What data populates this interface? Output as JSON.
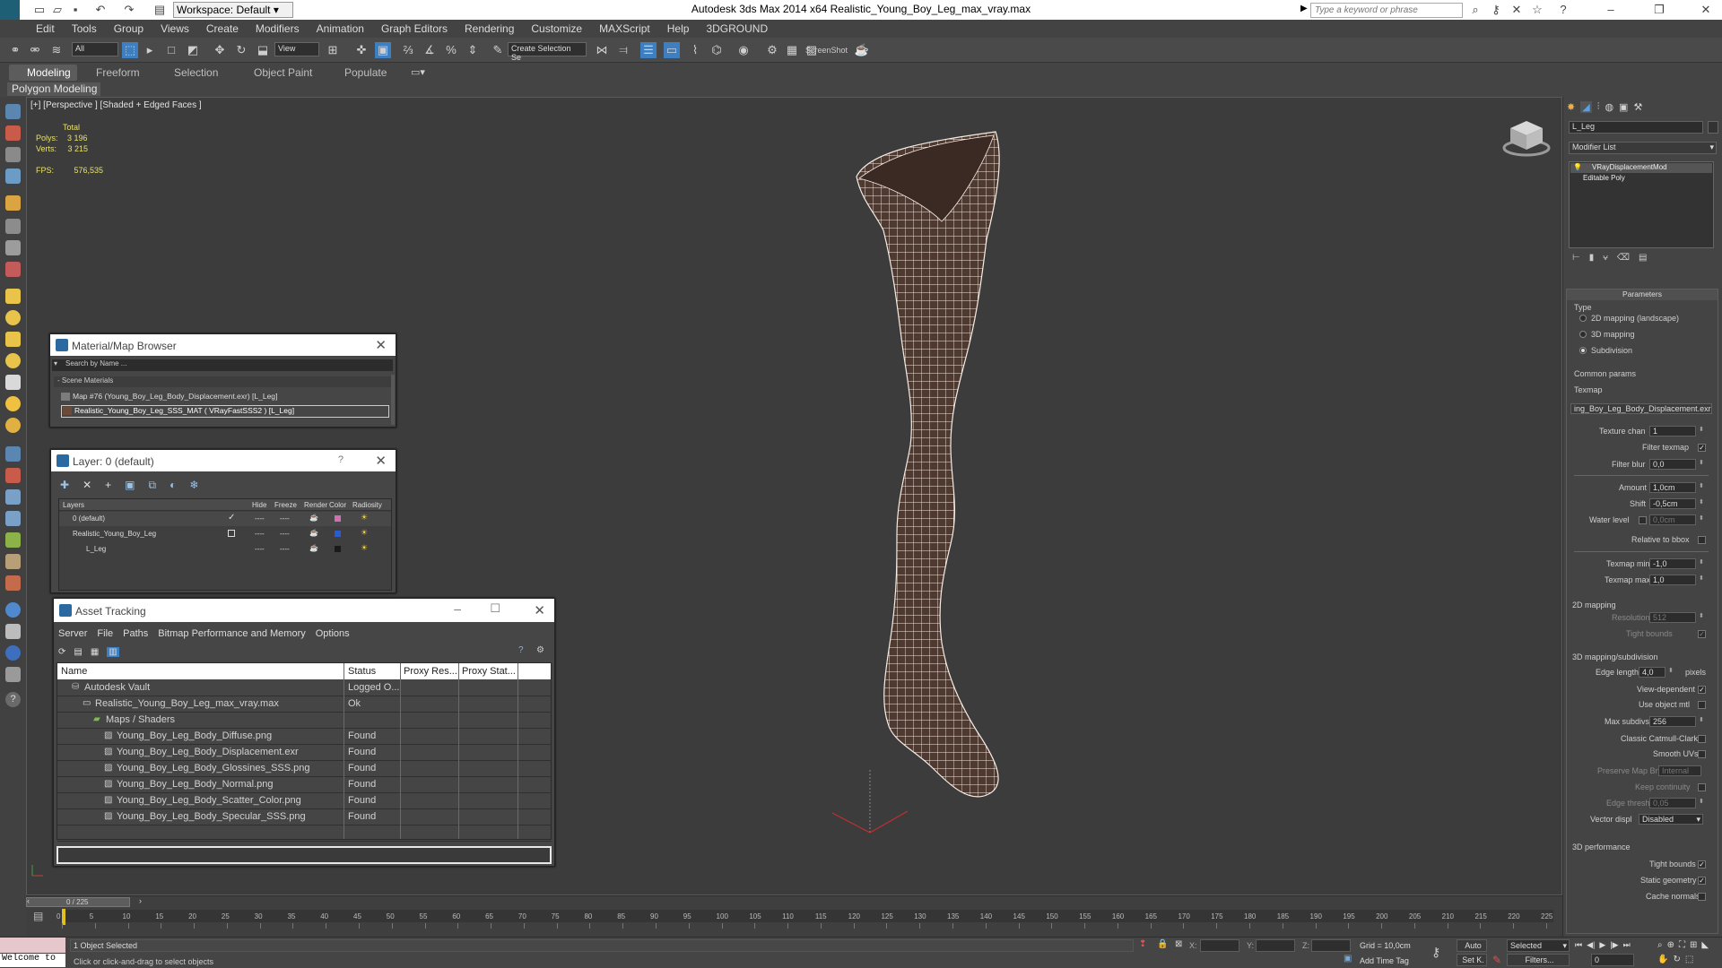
{
  "window": {
    "title": "Autodesk 3ds Max  2014 x64    Realistic_Young_Boy_Leg_max_vray.max",
    "workspace": "Workspace: Default",
    "search_placeholder": "Type a keyword or phrase"
  },
  "menu": [
    "Edit",
    "Tools",
    "Group",
    "Views",
    "Create",
    "Modifiers",
    "Animation",
    "Graph Editors",
    "Rendering",
    "Customize",
    "MAXScript",
    "Help",
    "3DGROUND"
  ],
  "toolbar": {
    "filter_all": "All",
    "ref_coord": "View",
    "named_selection": "Create Selection Se",
    "screenshot_label": "ScreenShot"
  },
  "ribbon": {
    "tabs": [
      "Modeling",
      "Freeform",
      "Selection",
      "Object Paint",
      "Populate"
    ],
    "active_tab": "Modeling",
    "sub_panel": "Polygon Modeling"
  },
  "viewport": {
    "label": "[+] [Perspective ] [Shaded + Edged Faces ]",
    "stats": {
      "total_label": "Total",
      "polys_label": "Polys:",
      "polys": "3 196",
      "verts_label": "Verts:",
      "verts": "3 215",
      "fps_label": "FPS:",
      "fps": "576,535"
    }
  },
  "material_browser": {
    "title": "Material/Map Browser",
    "search_placeholder": "Search by Name ...",
    "group": "- Scene Materials",
    "items": [
      "Map #76 (Young_Boy_Leg_Body_Displacement.exr) [L_Leg]",
      "Realistic_Young_Boy_Leg_SSS_MAT ( VRayFastSSS2 ) [L_Leg]"
    ]
  },
  "layer_panel": {
    "title": "Layer: 0 (default)",
    "help": "?",
    "columns": [
      "Layers",
      "Hide",
      "Freeze",
      "Render",
      "Color",
      "Radiosity"
    ],
    "rows": [
      {
        "name": "0 (default)",
        "color": "#d070b0"
      },
      {
        "name": "Realistic_Young_Boy_Leg",
        "color": "#2a5bd0"
      },
      {
        "name": "L_Leg",
        "color": "#1a1a1a"
      }
    ],
    "dashes": "----"
  },
  "asset_tracking": {
    "title": "Asset Tracking",
    "menu": [
      "Server",
      "File",
      "Paths",
      "Bitmap Performance and Memory",
      "Options"
    ],
    "columns": [
      "Name",
      "Status",
      "Proxy Res...",
      "Proxy Stat..."
    ],
    "rows": [
      {
        "name": "Autodesk Vault",
        "status": "Logged O...",
        "indent": 1,
        "icon": "vault"
      },
      {
        "name": "Realistic_Young_Boy_Leg_max_vray.max",
        "status": "Ok",
        "indent": 2,
        "icon": "file"
      },
      {
        "name": "Maps / Shaders",
        "status": "",
        "indent": 3,
        "icon": "folder"
      },
      {
        "name": "Young_Boy_Leg_Body_Diffuse.png",
        "status": "Found",
        "indent": 4,
        "icon": "image"
      },
      {
        "name": "Young_Boy_Leg_Body_Displacement.exr",
        "status": "Found",
        "indent": 4,
        "icon": "image"
      },
      {
        "name": "Young_Boy_Leg_Body_Glossines_SSS.png",
        "status": "Found",
        "indent": 4,
        "icon": "image"
      },
      {
        "name": "Young_Boy_Leg_Body_Normal.png",
        "status": "Found",
        "indent": 4,
        "icon": "image"
      },
      {
        "name": "Young_Boy_Leg_Body_Scatter_Color.png",
        "status": "Found",
        "indent": 4,
        "icon": "image"
      },
      {
        "name": "Young_Boy_Leg_Body_Specular_SSS.png",
        "status": "Found",
        "indent": 4,
        "icon": "image"
      }
    ]
  },
  "command_panel": {
    "object_name": "L_Leg",
    "modifier_list": "Modifier List",
    "stack": [
      "VRayDisplacementMod",
      "Editable Poly"
    ],
    "parameters_title": "Parameters",
    "type_label": "Type",
    "type_options": [
      "2D mapping (landscape)",
      "3D mapping",
      "Subdivision"
    ],
    "type_selected": "Subdivision",
    "common_params": "Common params",
    "texmap_label": "Texmap",
    "texmap_value": "ing_Boy_Leg_Body_Displacement.exr)",
    "texture_chan_label": "Texture chan",
    "texture_chan": "1",
    "filter_texmap": "Filter texmap",
    "filter_blur_label": "Filter blur",
    "filter_blur": "0,0",
    "amount_label": "Amount",
    "amount": "1,0cm",
    "shift_label": "Shift",
    "shift": "-0,5cm",
    "water_level_label": "Water level",
    "water_level": "0,0cm",
    "relative_bbox": "Relative to bbox",
    "texmap_min_label": "Texmap min",
    "texmap_min": "-1,0",
    "texmap_max_label": "Texmap max",
    "texmap_max": "1,0",
    "mapping_2d": "2D mapping",
    "resolution_label": "Resolution",
    "resolution": "512",
    "tight_bounds": "Tight bounds",
    "mapping_3d": "3D mapping/subdivision",
    "edge_length_label": "Edge length",
    "edge_length": "4,0",
    "pixels": "pixels",
    "view_dependent": "View-dependent",
    "use_object_mtl": "Use object mtl",
    "max_subdivs_label": "Max subdivs",
    "max_subdivs": "256",
    "classic_catmull": "Classic Catmull-Clark",
    "smooth_uvs": "Smooth UVs",
    "preserve_map_bnd": "Preserve Map Bnd",
    "preserve_value": "Internal",
    "keep_continuity": "Keep continuity",
    "edge_thresh_label": "Edge thresh",
    "edge_thresh": "0,05",
    "vector_displ_label": "Vector displ",
    "vector_displ": "Disabled",
    "performance": "3D performance",
    "perf_tight_bounds": "Tight bounds",
    "static_geometry": "Static geometry",
    "cache_normals": "Cache normals"
  },
  "timeline": {
    "frame_counter": "0 / 225",
    "ticks": [
      "0",
      "5",
      "10",
      "15",
      "20",
      "25",
      "30",
      "35",
      "40",
      "45",
      "50",
      "55",
      "60",
      "65",
      "70",
      "75",
      "80",
      "85",
      "90",
      "95",
      "100",
      "105",
      "110",
      "115",
      "120",
      "125",
      "130",
      "135",
      "140",
      "145",
      "150",
      "155",
      "160",
      "165",
      "170",
      "175",
      "180",
      "185",
      "190",
      "195",
      "200",
      "205",
      "210",
      "215",
      "220",
      "225"
    ]
  },
  "status": {
    "welcome": "Welcome to",
    "selection": "1 Object Selected",
    "prompt": "Click or click-and-drag to select objects",
    "x_label": "X:",
    "y_label": "Y:",
    "z_label": "Z:",
    "grid": "Grid = 10,0cm",
    "add_time_tag": "Add Time Tag",
    "auto": "Auto",
    "set_key": "Set K.",
    "selected": "Selected",
    "filters": "Filters...",
    "frame": "0"
  }
}
